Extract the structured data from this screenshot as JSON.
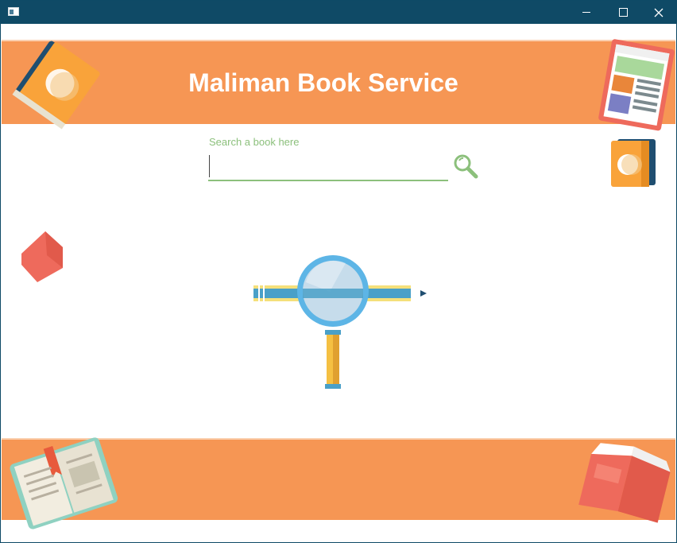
{
  "window": {
    "title": ""
  },
  "header": {
    "title": "Maliman Book Service"
  },
  "search": {
    "label": "Search a book here",
    "value": "",
    "placeholder": ""
  },
  "colors": {
    "titlebar": "#0f4a66",
    "banner": "#f69654",
    "accent": "#8cc07c"
  },
  "icons": {
    "search_button": "search-icon",
    "center": "magnifier-pencil-icon"
  }
}
